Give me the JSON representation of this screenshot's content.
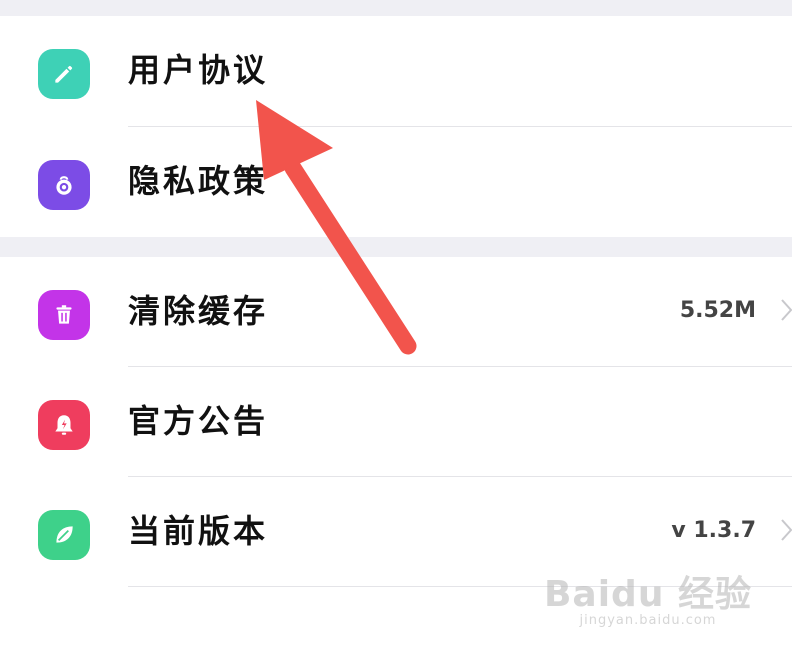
{
  "sections": [
    {
      "items": [
        {
          "label": "用户协议",
          "icon": "pencil-icon",
          "color": "#3ed1b6"
        },
        {
          "label": "隐私政策",
          "icon": "privacy-lock-icon",
          "color": "#7c4ce6"
        }
      ]
    },
    {
      "items": [
        {
          "label": "清除缓存",
          "icon": "trash-icon",
          "color": "#c334e8",
          "value": "5.52M"
        },
        {
          "label": "官方公告",
          "icon": "bell-icon",
          "color": "#ef3d5e"
        },
        {
          "label": "当前版本",
          "icon": "leaf-icon",
          "color": "#3ed18a",
          "value": "v 1.3.7"
        }
      ]
    }
  ],
  "watermark": {
    "logo": "Baidu 经验",
    "url": "jingyan.baidu.com"
  },
  "colors": {
    "section_gap": "#efeff4",
    "divider": "#e4e4e8",
    "arrow": "#f2544c"
  }
}
